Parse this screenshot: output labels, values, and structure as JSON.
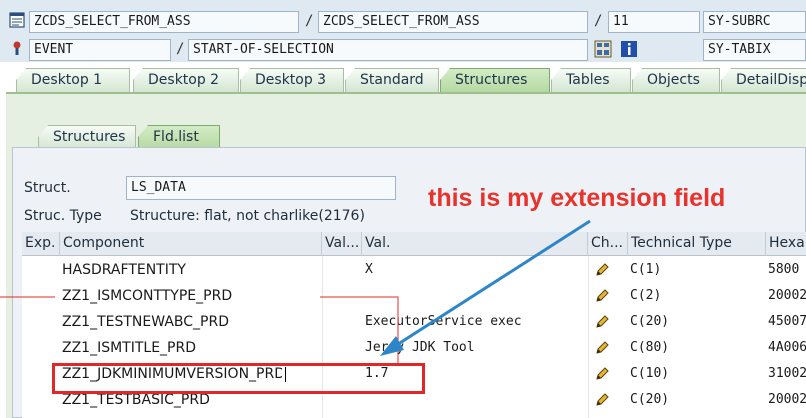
{
  "toolbar": {
    "row1": {
      "field1": "ZCDS_SELECT_FROM_ASS",
      "sep1": "/",
      "field2": "ZCDS_SELECT_FROM_ASS",
      "sep2": "/",
      "line": "11",
      "sysfield": "SY-SUBRC"
    },
    "row2": {
      "event_label": "EVENT",
      "sep": "/",
      "event_value": "START-OF-SELECTION",
      "sysfield": "SY-TABIX"
    }
  },
  "tabs": [
    "Desktop 1",
    "Desktop 2",
    "Desktop 3",
    "Standard",
    "Structures",
    "Tables",
    "Objects",
    "DetailDispla"
  ],
  "active_tab": "Structures",
  "subtabs": [
    "Structures",
    "Fld.list"
  ],
  "active_subtab": "Fld.list",
  "struct": {
    "label": "Struct.",
    "value": "LS_DATA",
    "type_label": "Struc. Type",
    "type_value": "Structure: flat, not charlike(2176)"
  },
  "grid": {
    "headers": [
      "Exp.",
      "Component",
      "Val...",
      "Val.",
      "Ch...",
      "Technical Type",
      "Hexa"
    ],
    "rows": [
      {
        "component": "HASDRAFTENTITY",
        "value": "X",
        "type": "C(1)",
        "hex": "5800"
      },
      {
        "component": "ZZ1_ISMCONTTYPE_PRD",
        "value": "",
        "type": "C(2)",
        "hex": "20002"
      },
      {
        "component": "ZZ1_TESTNEWABC_PRD",
        "value": "ExecutorService exec",
        "type": "C(20)",
        "hex": "45007"
      },
      {
        "component": "ZZ1_ISMTITLE_PRD",
        "value": "Jerry JDK Tool",
        "type": "C(80)",
        "hex": "4A006"
      },
      {
        "component": "ZZ1_JDKMINIMUMVERSION_PRD",
        "value": "1.7",
        "type": "C(10)",
        "hex": "31002"
      },
      {
        "component": "ZZ1_TESTBASIC_PRD",
        "value": "",
        "type": "C(20)",
        "hex": "20002"
      }
    ]
  },
  "annotation": {
    "text": "this is my extension field",
    "color": "#e8322c"
  },
  "colors": {
    "accent_green": "#b6d9a3",
    "highlight_red": "#e0282a",
    "arrow_blue": "#2e86c8"
  }
}
